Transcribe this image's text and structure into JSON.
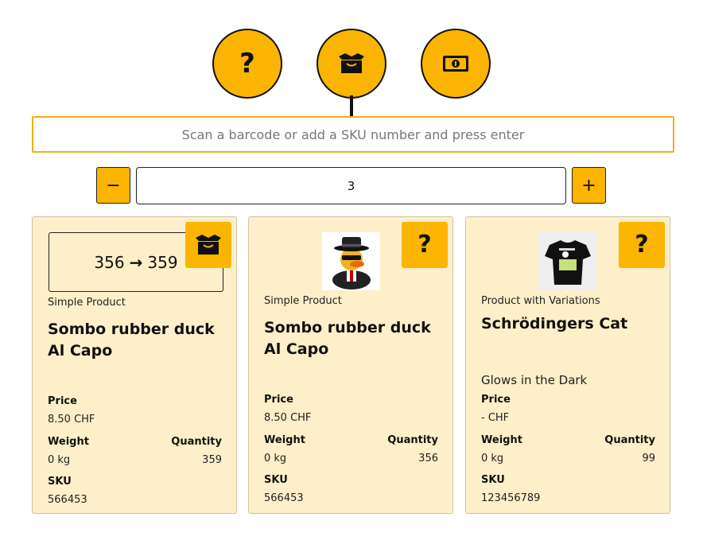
{
  "top_buttons": [
    {
      "name": "help",
      "glyph": "?"
    },
    {
      "name": "box-icon"
    },
    {
      "name": "money-icon"
    }
  ],
  "scan": {
    "placeholder": "Scan a barcode or add a SKU number and press enter"
  },
  "quantity": {
    "minus_label": "−",
    "value": "3",
    "plus_label": "+"
  },
  "labels": {
    "price": "Price",
    "weight": "Weight",
    "quantity": "Quantity",
    "sku": "SKU"
  },
  "cards": [
    {
      "stock_from": "356",
      "stock_to": "359",
      "type": "Simple Product",
      "title": "Sombo rubber duck Al Capo",
      "price": "8.50 CHF",
      "weight": "0 kg",
      "quantity": "359",
      "sku": "566453",
      "corner_icon": "box-icon"
    },
    {
      "type": "Simple Product",
      "title": "Sombo rubber duck Al Capo",
      "price": "8.50 CHF",
      "weight": "0 kg",
      "quantity": "356",
      "sku": "566453",
      "corner_glyph": "?",
      "image": "rubber-duck-gangster-image"
    },
    {
      "type": "Product with Variations",
      "title": "Schrödingers Cat",
      "description": "Glows in the Dark",
      "price": "- CHF",
      "weight": "0 kg",
      "quantity": "99",
      "sku": "123456789",
      "corner_glyph": "?",
      "image": "black-cat-tshirt-image"
    }
  ],
  "colors": {
    "accent": "#fbb500",
    "card_bg": "#fdefc9",
    "scan_border": "#f2ae1a"
  }
}
